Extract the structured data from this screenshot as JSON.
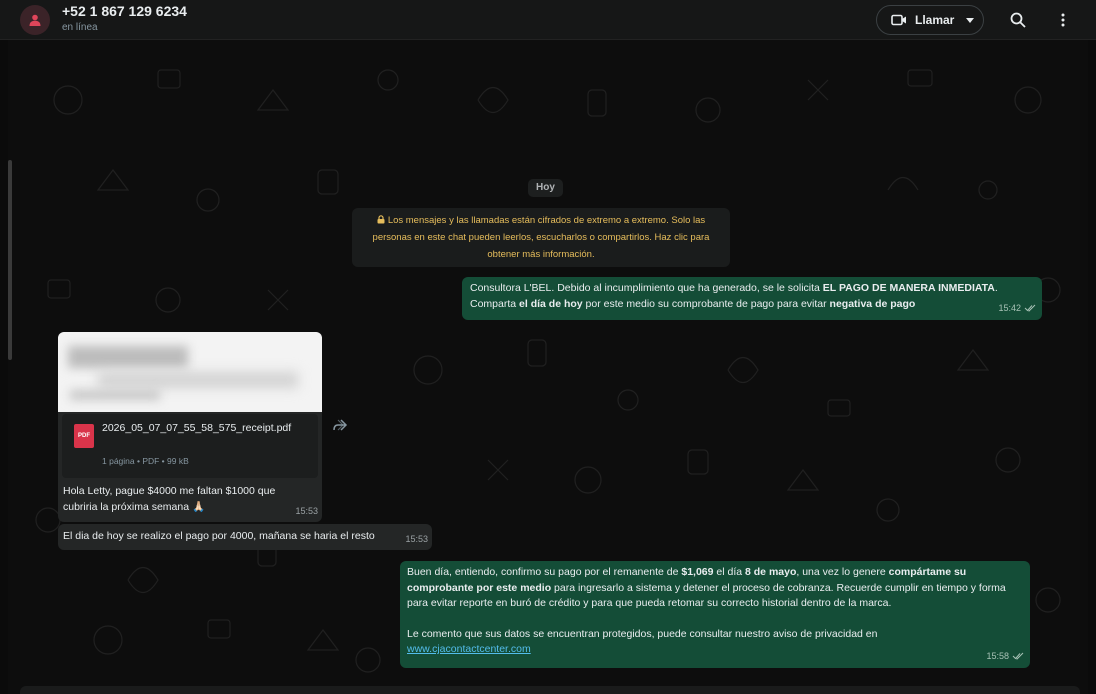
{
  "header": {
    "contact_name": "+52 1 867 129 6234",
    "status": "en línea",
    "call_label": "Llamar",
    "icons": [
      "avatar-person-icon",
      "video-icon",
      "chevron-down-icon",
      "search-icon",
      "menu-dots-icon"
    ]
  },
  "chat": {
    "date_label": "Hoy",
    "encryption_notice": "Los mensajes y las llamadas están cifrados de extremo a extremo. Solo las personas en este chat pueden leerlos, escucharlos o compartirlos. Haz clic para obtener más información.",
    "messages": {
      "m1": {
        "direction": "outgoing",
        "p1": "Consultora L'BEL. Debido al incumplimiento que ha generado, se le solicita ",
        "b1": "EL PAGO DE MANERA INMEDIATA",
        "p2": ". Comparta ",
        "b2": "el día de hoy",
        "p3": " por este medio su comprobante de pago para evitar ",
        "b3": "negativa de pago",
        "time": "15:42"
      },
      "m2": {
        "direction": "incoming",
        "file_name": "2026_05_07_07_55_58_575_receipt.pdf",
        "file_type_badge": "PDF",
        "file_meta": "1 página • PDF • 99 kB",
        "caption": "Hola Letty, pague $4000 me faltan $1000 que cubriria la próxima semana 🙏🏻",
        "time": "15:53"
      },
      "m3": {
        "direction": "incoming",
        "text": "El dia de hoy se realizo el pago por 4000, mañana se haria el resto",
        "time": "15:53"
      },
      "m4": {
        "direction": "outgoing",
        "p1": "Buen día, entiendo, confirmo su pago por el remanente de ",
        "b1": "$1,069",
        "p2": " el día ",
        "b2": "8 de mayo",
        "p3": ", una vez lo genere ",
        "b3": "compártame su comprobante por este medio",
        "p4": " para ingresarlo a sistema y detener el proceso de cobranza. Recuerde cumplir en tiempo y forma para evitar reporte en buró de crédito y para que pueda retomar su correcto historial dentro de la marca.",
        "p5": "Le comento que sus datos se encuentran protegidos, puede consultar nuestro aviso de privacidad en",
        "link": "www.cjacontactcenter.com",
        "time": "15:58"
      }
    }
  },
  "colors": {
    "outgoing_bubble": "#144d37",
    "incoming_bubble": "#242626",
    "system_text": "#e6bd5c",
    "link": "#53bdeb",
    "header_bg": "#161717"
  }
}
